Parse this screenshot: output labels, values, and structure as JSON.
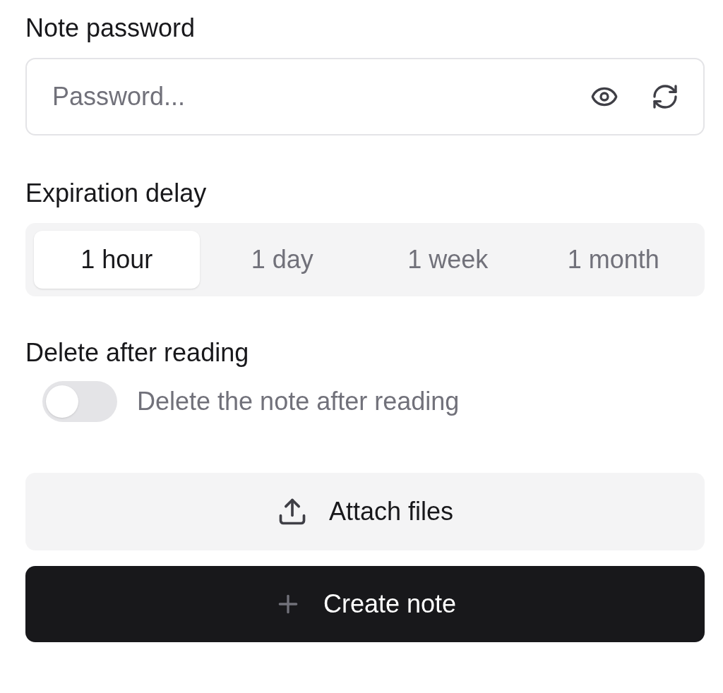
{
  "password": {
    "label": "Note password",
    "placeholder": "Password..."
  },
  "expiration": {
    "label": "Expiration delay",
    "options": [
      {
        "label": "1 hour",
        "selected": true
      },
      {
        "label": "1 day",
        "selected": false
      },
      {
        "label": "1 week",
        "selected": false
      },
      {
        "label": "1 month",
        "selected": false
      }
    ]
  },
  "delete_after_reading": {
    "label": "Delete after reading",
    "toggle_label": "Delete the note after reading",
    "on": false
  },
  "buttons": [
    {
      "kind": "secondary",
      "label": "Attach files"
    },
    {
      "kind": "primary",
      "label": "Create note"
    }
  ]
}
